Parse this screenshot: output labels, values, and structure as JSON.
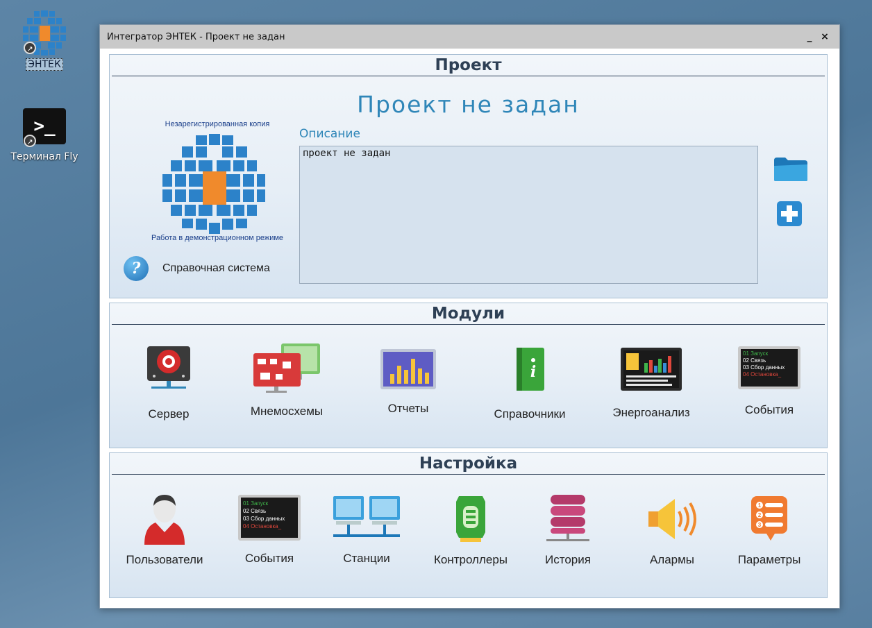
{
  "desktop": {
    "icons": [
      {
        "label": "ЭНТЕК"
      },
      {
        "label": "Терминал Fly"
      }
    ]
  },
  "window": {
    "title": "Интегратор ЭНТЕК - Проект не задан",
    "minimize": "_",
    "close": "×"
  },
  "project": {
    "header": "Проект",
    "name": "Проект не задан",
    "unregistered": "Незарегистрированная копия",
    "demo_mode": "Работа в демонстрационном режиме",
    "help_label": "Справочная система",
    "description_label": "Описание",
    "description_value": "проект не задан"
  },
  "modules": {
    "header": "Модули",
    "items": [
      {
        "label": "Сервер"
      },
      {
        "label": "Мнемосхемы"
      },
      {
        "label": "Отчеты"
      },
      {
        "label": "Справочники"
      },
      {
        "label": "Энергоанализ"
      },
      {
        "label": "События"
      }
    ]
  },
  "events_screen": {
    "lines": [
      "01 Запуск",
      "02 Связь",
      "03 Сбор данных",
      "04 Остановка_"
    ]
  },
  "settings": {
    "header": "Настройка",
    "items": [
      {
        "label": "Пользователи"
      },
      {
        "label": "События"
      },
      {
        "label": "Станции"
      },
      {
        "label": "Контроллеры"
      },
      {
        "label": "История"
      },
      {
        "label": "Алармы"
      },
      {
        "label": "Параметры"
      }
    ]
  },
  "colors": {
    "accent": "#2f86b8",
    "header_text": "#2e4055",
    "demo_text": "#1a3f8a"
  }
}
